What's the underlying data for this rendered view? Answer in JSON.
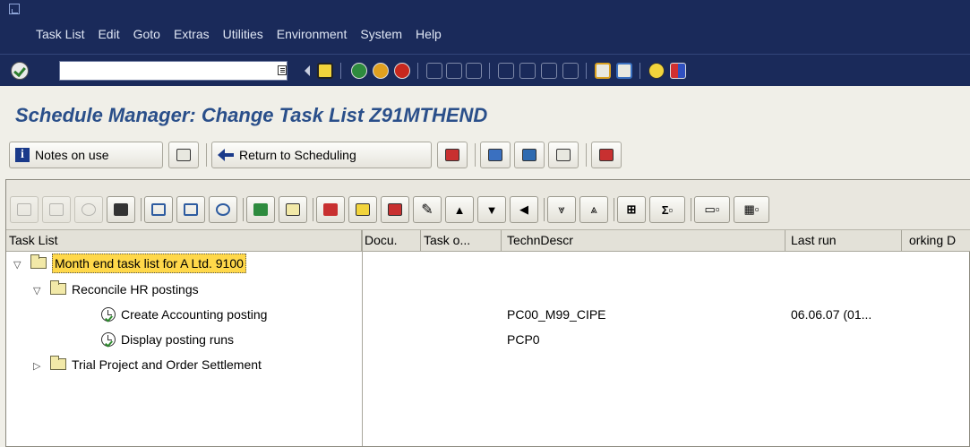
{
  "menu": [
    "Task List",
    "Edit",
    "Goto",
    "Extras",
    "Utilities",
    "Environment",
    "System",
    "Help"
  ],
  "command_field": {
    "value": ""
  },
  "title": "Schedule Manager: Change Task List Z91MTHEND",
  "app_toolbar": {
    "notes_label": "Notes on use",
    "return_label": "Return to Scheduling"
  },
  "columns": [
    "Task List",
    "Docu.",
    "Task o...",
    "TechnDescr",
    "Last run",
    "orking D"
  ],
  "rows": [
    {
      "label": "Month end task list for A Ltd. 9100",
      "techn": "",
      "last_run": ""
    },
    {
      "label": "Reconcile HR postings",
      "techn": "",
      "last_run": ""
    },
    {
      "label": "Create Accounting posting",
      "techn": "PC00_M99_CIPE",
      "last_run": "06.06.07  (01..."
    },
    {
      "label": "Display posting runs",
      "techn": "PCP0",
      "last_run": ""
    },
    {
      "label": "Trial  Project and Order Settlement",
      "techn": "",
      "last_run": ""
    }
  ],
  "colors": {
    "menubar": "#1a2a5a",
    "title": "#2a4f8a",
    "selection": "#ffd84a"
  }
}
